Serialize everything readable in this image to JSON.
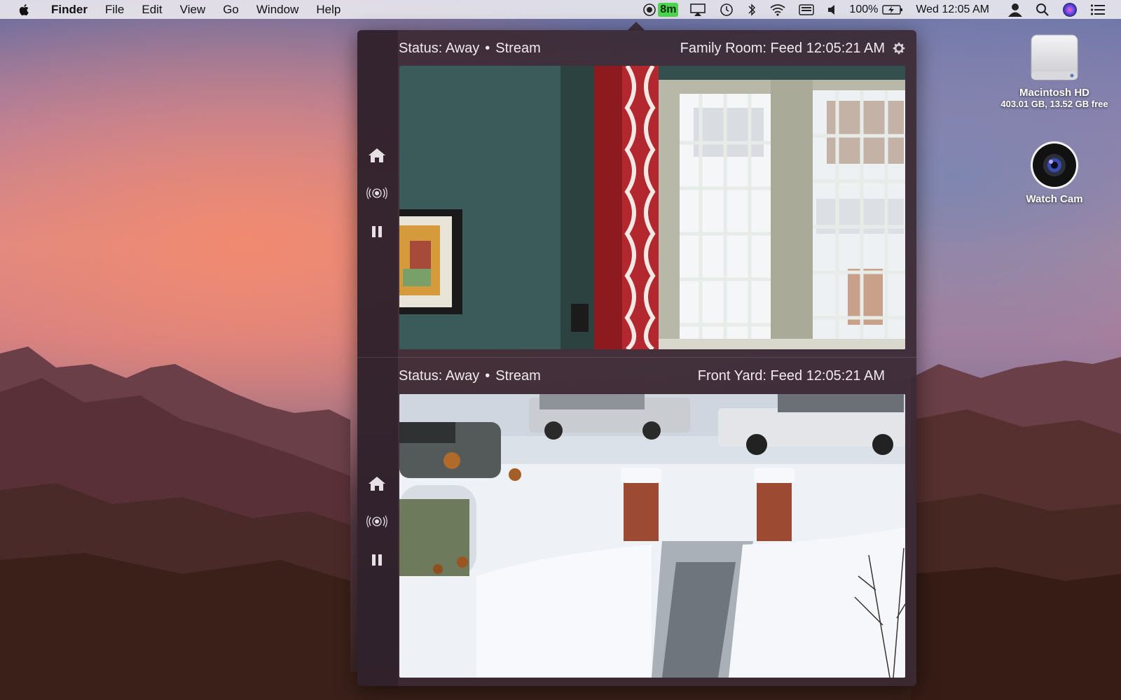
{
  "menubar": {
    "app_name": "Finder",
    "menus": [
      "File",
      "Edit",
      "View",
      "Go",
      "Window",
      "Help"
    ],
    "status": {
      "timer_badge": "8m",
      "battery_percent": "100%",
      "clock": "Wed 12:05 AM"
    },
    "icons": [
      "apple-icon",
      "record-icon",
      "airplay-icon",
      "time-machine-icon",
      "bluetooth-icon",
      "wifi-icon",
      "input-menu-icon",
      "volume-icon",
      "battery-icon",
      "user-icon",
      "spotlight-icon",
      "siri-icon",
      "notification-center-icon"
    ]
  },
  "cameras": [
    {
      "status": "Status: Away",
      "mode": "Stream",
      "feed_title": "Family Room: Feed 12:05:21 AM"
    },
    {
      "status": "Status: Away",
      "mode": "Stream",
      "feed_title": "Front Yard: Feed 12:05:21 AM"
    }
  ],
  "sidebar_icons": [
    "home-icon",
    "motion-detect-icon",
    "pause-icon"
  ],
  "desktop": {
    "disk": {
      "name": "Macintosh HD",
      "detail": "403.01 GB, 13.52 GB free"
    },
    "app": {
      "name": "Watch Cam"
    }
  },
  "colors": {
    "timer_badge": "#4dd44f",
    "popover_bg": "#3a2a34"
  }
}
